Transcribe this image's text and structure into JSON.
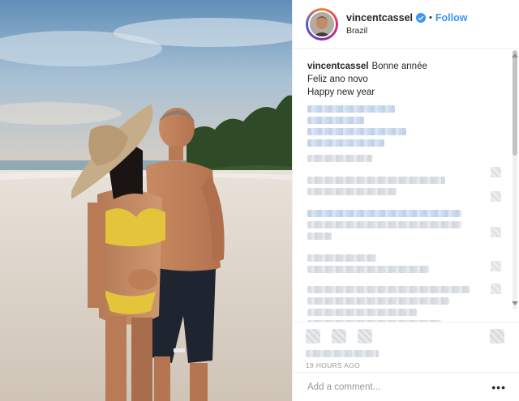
{
  "header": {
    "username": "vincentcassel",
    "verified_icon": "verified-badge-icon",
    "separator": "•",
    "follow_label": "Follow",
    "location": "Brazil"
  },
  "caption": {
    "username": "vincentcassel",
    "lines": [
      "Bonne année",
      "Feliz ano novo",
      "Happy new year"
    ]
  },
  "actions": {
    "icons": [
      "heart-icon",
      "comment-icon",
      "share-icon",
      "bookmark-icon"
    ],
    "timestamp": "19 HOURS AGO"
  },
  "add_comment": {
    "placeholder": "Add a comment...",
    "more_label": "•••"
  },
  "colors": {
    "accent": "#3897f0",
    "verified": "#3897f0",
    "text": "#262626",
    "muted": "#999999"
  }
}
